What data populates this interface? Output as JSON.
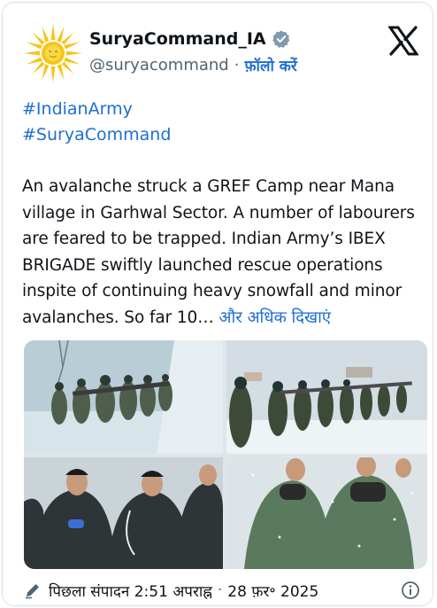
{
  "author": {
    "name": "SuryaCommand_IA",
    "handle": "@suryacommand",
    "separator": "·",
    "follow_label": "फ़ॉलो करें"
  },
  "hashtags": [
    "#IndianArmy",
    "#SuryaCommand"
  ],
  "post": {
    "text": "An avalanche struck a GREF Camp near Mana village in Garhwal Sector. A number of labourers are feared to be trapped. Indian Army’s IBEX BRIGADE swiftly launched rescue operations inspite of continuing heavy snowfall and minor avalanches. So far 10…",
    "show_more": "और अधिक दिखाएं"
  },
  "footer": {
    "edited_label": "पिछला संपादन",
    "time": "2:51 अपराह्न",
    "separator": "·",
    "date": "28 फ़र॰ 2025"
  },
  "icons": {
    "avatar": "sun-logo-icon",
    "verified": "verified-badge-icon",
    "platform": "x-logo-icon",
    "edit": "pencil-icon",
    "info": "info-icon"
  },
  "colors": {
    "link": "#1d6fd1",
    "text": "#0f1419",
    "muted": "#536471",
    "sun": "#f5c518"
  }
}
